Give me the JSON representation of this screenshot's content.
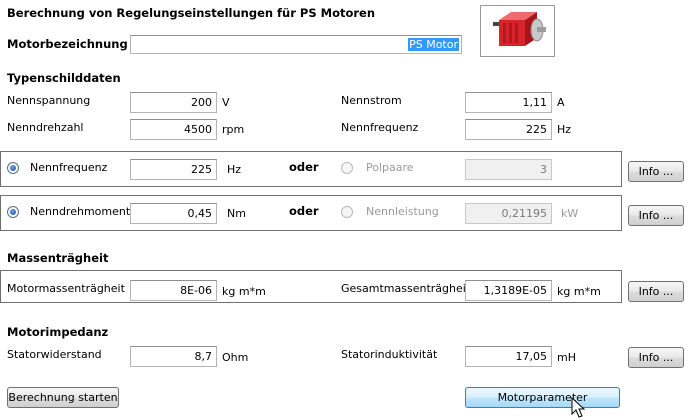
{
  "title": "Berechnung von Regelungseinstellungen für PS Motoren",
  "motor": {
    "label": "Motorbezeichnung",
    "value": "PS Motor"
  },
  "typenschild": {
    "heading": "Typenschilddaten",
    "nennspannung": {
      "label": "Nennspannung",
      "value": "200",
      "unit": "V"
    },
    "nennstrom": {
      "label": "Nennstrom",
      "value": "1,11",
      "unit": "A"
    },
    "nenndrehzahl": {
      "label": "Nenndrehzahl",
      "value": "4500",
      "unit": "rpm"
    },
    "nennfrequenz": {
      "label": "Nennfrequenz",
      "value": "225",
      "unit": "Hz"
    }
  },
  "group1": {
    "opt_a": {
      "label": "Nennfrequenz",
      "value": "225",
      "unit": "Hz",
      "selected": true
    },
    "oder": "oder",
    "opt_b": {
      "label": "Polpaare",
      "value": "3",
      "unit": "",
      "selected": false
    },
    "info": "Info ..."
  },
  "group2": {
    "opt_a": {
      "label": "Nenndrehmoment",
      "value": "0,45",
      "unit": "Nm",
      "selected": true
    },
    "oder": "oder",
    "opt_b": {
      "label": "Nennleistung",
      "value": "0,21195",
      "unit": "kW",
      "selected": false
    },
    "info": "Info ..."
  },
  "masse": {
    "heading": "Massenträgheit",
    "motor": {
      "label": "Motormassenträgheit",
      "value": "8E-06",
      "unit": "kg m*m"
    },
    "gesamt": {
      "label": "Gesamtmassenträgheit",
      "value": "1,3189E-05",
      "unit": "kg m*m"
    },
    "info": "Info ..."
  },
  "impedanz": {
    "heading": "Motorimpedanz",
    "widerstand": {
      "label": "Statorwiderstand",
      "value": "8,7",
      "unit": "Ohm"
    },
    "induktivitaet": {
      "label": "Statorinduktivität",
      "value": "17,05",
      "unit": "mH"
    },
    "info": "Info ..."
  },
  "buttons": {
    "start": "Berechnung starten",
    "params": "Motorparameter"
  },
  "icons": {
    "motor": "motor-image-icon",
    "cursor": "mouse-cursor-icon"
  },
  "colors": {
    "selection": "#3399ff",
    "motor_red": "#d8232a",
    "button_hot": "#bee6fd"
  }
}
